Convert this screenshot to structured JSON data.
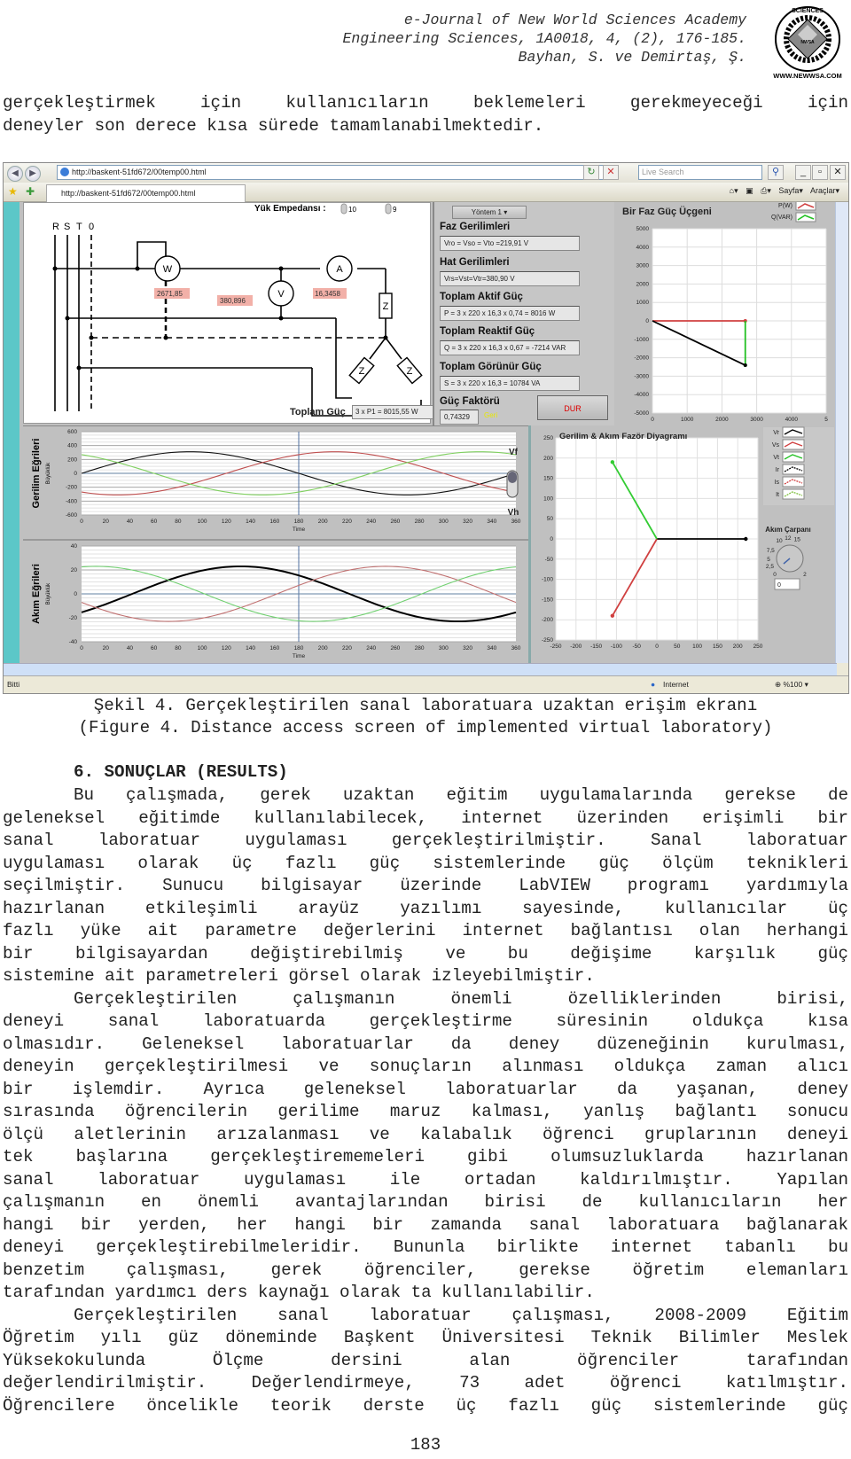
{
  "header": {
    "journal": "e-Journal of New World Sciences Academy",
    "citation": "Engineering Sciences, 1A0018, 4, (2), 176-185.",
    "authors": "Bayhan, S. ve Demirtaş, Ş.",
    "logo_top": "SCIENCES",
    "logo_left": "NEW WORLD",
    "logo_right": "ACADEMY",
    "logo_center": "NWSA",
    "logo_url": "WWW.NEWWSA.COM"
  },
  "intro_paragraph": {
    "line1": "gerçekleştirmek için kullanıcıların beklemeleri gerekmeyeceği için",
    "line2": "deneyler son derece kısa sürede tamamlanabilmektedir."
  },
  "browser": {
    "address": "http://baskent-51fd672/00temp00.html",
    "tab_title": "http://baskent-51fd672/00temp00.html",
    "search_placeholder": "Live Search",
    "toolbar": {
      "page": "Sayfa",
      "tools": "Araçlar"
    },
    "status_text": "Bitti",
    "zone": "Internet",
    "zoom": "%100"
  },
  "labview": {
    "circuit": {
      "lines": [
        "R",
        "S",
        "T",
        "0"
      ],
      "load_impedance_label": "Yük Empedansı :",
      "impedance_1": "10",
      "impedance_2": "9",
      "wattmeter": "W",
      "voltmeter": "V",
      "ammeter": "A",
      "load": "Z",
      "watt_reading": "2671,85",
      "volt_reading": "380,896",
      "amp_reading": "16,3458",
      "total_power_label": "Toplam Güç",
      "total_power_value": "3 x P1 = 8015,55 W"
    },
    "controls": {
      "method": "Yöntem 1",
      "phase_voltages_label": "Faz Gerilimleri",
      "phase_voltages": "Vro = Vso = Vto =219,91 V",
      "line_voltages_label": "Hat Gerilimleri",
      "line_voltages": "Vrs=Vst=Vtr=380,90 V",
      "active_power_label": "Toplam Aktif Güç",
      "active_power": "P = 3 x 220 x 16,3 x 0,74 = 8016 W",
      "reactive_power_label": "Toplam Reaktif Güç",
      "reactive_power": "Q = 3 x 220 x 16,3 x 0,67 = -7214 VAR",
      "apparent_power_label": "Toplam Görünür Güç",
      "apparent_power": "S = 3 x 220 x 16,3 = 10784 VA",
      "power_factor_label": "Güç Faktörü",
      "power_factor": "0,74329",
      "pf_type": "Geri",
      "stop_button": "DUR",
      "toggle_top": "Vf",
      "toggle_bottom": "Vh",
      "current_multiplier_label": "Akım Çarpanı",
      "current_multiplier_value": "0",
      "knob_ticks": [
        "0",
        "2,5",
        "5",
        "7,5",
        "10",
        "12",
        "15",
        "2"
      ]
    }
  },
  "chart_data": [
    {
      "type": "line",
      "title": "Bir Faz Güç Üçgeni",
      "legend": [
        "P(W)",
        "Q(VAR)"
      ],
      "legend_colors": [
        "#d04040",
        "#22c022"
      ],
      "xlim": [
        0,
        5000
      ],
      "ylim": [
        -5000,
        5000
      ],
      "xticks": [
        "0",
        "1000",
        "2000",
        "3000",
        "4000",
        "5"
      ],
      "yticks": [
        "5000",
        "4000",
        "3000",
        "2000",
        "1000",
        "0",
        "-1000",
        "-2000",
        "-3000",
        "-4000",
        "-5000"
      ],
      "series": [
        {
          "name": "P(W)",
          "color": "#d04040",
          "points": [
            [
              0,
              0
            ],
            [
              2672,
              0
            ]
          ]
        },
        {
          "name": "Q(VAR)",
          "color": "#22c022",
          "points": [
            [
              2672,
              0
            ],
            [
              2672,
              -2405
            ]
          ]
        },
        {
          "name": "S",
          "color": "#000000",
          "points": [
            [
              0,
              0
            ],
            [
              2672,
              -2405
            ]
          ]
        }
      ]
    },
    {
      "type": "line",
      "title": "Gerilim Eğrileri",
      "ylabel": "Büyüklük",
      "xlabel": "Time",
      "xlim": [
        0,
        360
      ],
      "ylim": [
        -600,
        600
      ],
      "xticks": [
        "0",
        "20",
        "40",
        "60",
        "80",
        "100",
        "120",
        "140",
        "160",
        "180",
        "200",
        "220",
        "240",
        "260",
        "280",
        "300",
        "320",
        "340",
        "360"
      ],
      "yticks": [
        "600",
        "400",
        "200",
        "0",
        "-200",
        "-400",
        "-600"
      ],
      "amplitude": 311,
      "series": [
        {
          "name": "Vr",
          "color": "#111111",
          "phase_deg": 0
        },
        {
          "name": "Vs",
          "color": "#c05050",
          "phase_deg": -120
        },
        {
          "name": "Vt",
          "color": "#80d060",
          "phase_deg": 120
        }
      ]
    },
    {
      "type": "line",
      "title": "Akım Eğrileri",
      "ylabel": "Büyüklük",
      "xlabel": "Time",
      "xlim": [
        0,
        360
      ],
      "ylim": [
        -40,
        40
      ],
      "xticks": [
        "0",
        "20",
        "40",
        "60",
        "80",
        "100",
        "120",
        "140",
        "160",
        "180",
        "200",
        "220",
        "240",
        "260",
        "280",
        "300",
        "320",
        "340",
        "360"
      ],
      "yticks": [
        "40",
        "20",
        "0",
        "-20",
        "-40"
      ],
      "amplitude": 23,
      "series": [
        {
          "name": "Ir",
          "color": "#000000",
          "phase_deg": -42
        },
        {
          "name": "Is",
          "color": "#c07070",
          "phase_deg": -162
        },
        {
          "name": "It",
          "color": "#70d070",
          "phase_deg": 78
        }
      ]
    },
    {
      "type": "line",
      "title": "Gerilim & Akım Fazör Diyagramı",
      "legend": [
        "Vr",
        "Vs",
        "Vt",
        "Ir",
        "Is",
        "It"
      ],
      "legend_colors": [
        "#000000",
        "#d04040",
        "#22c022",
        "#000000",
        "#d04040",
        "#80c040"
      ],
      "xlim": [
        -250,
        250
      ],
      "ylim": [
        -250,
        250
      ],
      "xticks": [
        "-250",
        "-200",
        "-150",
        "-100",
        "-50",
        "0",
        "50",
        "100",
        "150",
        "200",
        "250"
      ],
      "yticks": [
        "250",
        "200",
        "150",
        "100",
        "50",
        "0",
        "-50",
        "-100",
        "-150",
        "-200",
        "-250"
      ],
      "series": [
        {
          "name": "Vr",
          "color": "#000000",
          "points": [
            [
              0,
              0
            ],
            [
              220,
              0
            ]
          ]
        },
        {
          "name": "Vs",
          "color": "#d04040",
          "points": [
            [
              0,
              0
            ],
            [
              -110,
              -190
            ]
          ]
        },
        {
          "name": "Vt",
          "color": "#33cc33",
          "points": [
            [
              0,
              0
            ],
            [
              -110,
              190
            ]
          ]
        }
      ]
    }
  ],
  "figure_caption": {
    "tr": "Şekil 4. Gerçekleştirilen sanal laboratuara uzaktan erişim ekranı",
    "en": "(Figure 4. Distance access screen of implemented virtual laboratory)"
  },
  "section": {
    "heading": "6. SONUÇLAR (RESULTS)",
    "paragraphs": [
      [
        "Bu çalışmada, gerek uzaktan eğitim uygulamalarında gerekse de",
        "geleneksel eğitimde kullanılabilecek, internet üzerinden erişimli bir",
        "sanal laboratuar uygulaması gerçekleştirilmiştir. Sanal laboratuar",
        "uygulaması olarak üç fazlı güç sistemlerinde güç ölçüm teknikleri",
        "seçilmiştir. Sunucu bilgisayar üzerinde LabVIEW programı yardımıyla",
        "hazırlanan etkileşimli arayüz yazılımı sayesinde, kullanıcılar üç",
        "fazlı yüke ait parametre değerlerini internet bağlantısı olan herhangi",
        "bir bilgisayardan değiştirebilmiş ve bu değişime karşılık güç",
        "sistemine ait parametreleri görsel olarak izleyebilmiştir."
      ],
      [
        "Gerçekleştirilen çalışmanın önemli özelliklerinden birisi,",
        "deneyi sanal laboratuarda gerçekleştirme süresinin oldukça kısa",
        "olmasıdır. Geleneksel laboratuarlar da deney düzeneğinin kurulması,",
        "deneyin gerçekleştirilmesi ve sonuçların alınması oldukça zaman alıcı",
        "bir işlemdir. Ayrıca geleneksel laboratuarlar da yaşanan, deney",
        "sırasında öğrencilerin gerilime maruz kalması, yanlış bağlantı sonucu",
        "ölçü aletlerinin arızalanması ve kalabalık öğrenci gruplarının deneyi",
        "tek başlarına gerçekleştirememeleri gibi olumsuzluklarda hazırlanan",
        "sanal laboratuar uygulaması ile ortadan kaldırılmıştır. Yapılan",
        "çalışmanın en önemli avantajlarından birisi de kullanıcıların her",
        "hangi bir yerden, her hangi bir zamanda sanal laboratuara bağlanarak",
        "deneyi gerçekleştirebilmeleridir. Bununla birlikte internet tabanlı bu",
        "benzetim çalışması, gerek öğrenciler, gerekse öğretim elemanları",
        "tarafından yardımcı ders kaynağı olarak ta kullanılabilir."
      ],
      [
        "Gerçekleştirilen sanal laboratuar çalışması, 2008-2009 Eğitim",
        "Öğretim yılı güz döneminde Başkent Üniversitesi Teknik Bilimler Meslek",
        "Yüksekokulunda Ölçme dersini alan öğrenciler tarafından",
        "değerlendirilmiştir. Değerlendirmeye, 73 adet öğrenci katılmıştır.",
        "Öğrencilere öncelikle teorik derste üç fazlı güç sistemlerinde güç"
      ]
    ]
  },
  "page_number": "183"
}
